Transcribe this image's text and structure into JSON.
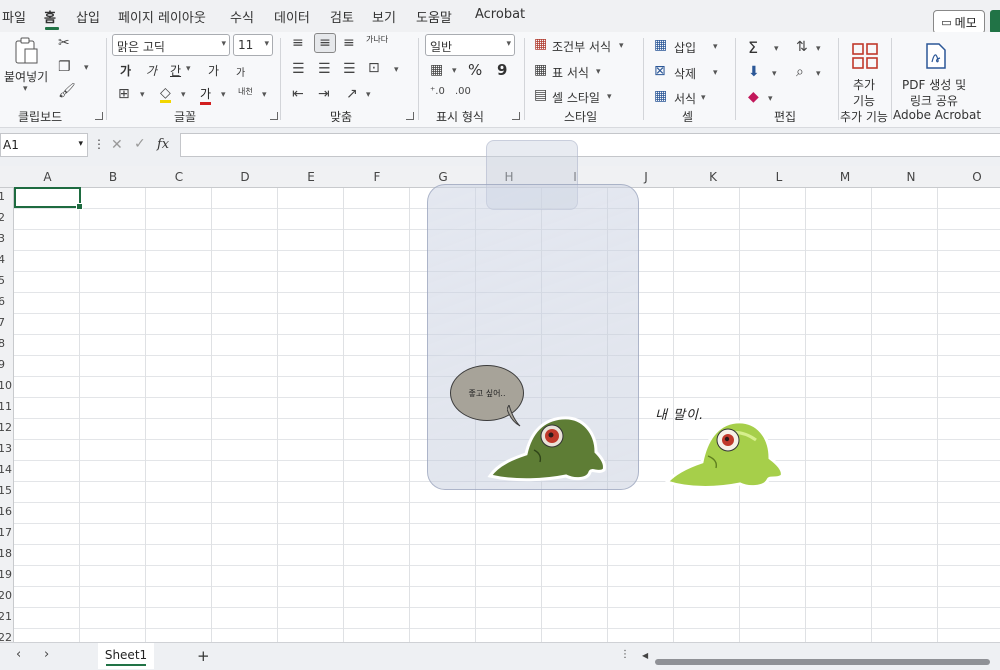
{
  "menu": {
    "items": [
      "파일",
      "홈",
      "삽입",
      "페이지 레이아웃",
      "수식",
      "데이터",
      "검토",
      "보기",
      "도움말",
      "Acrobat"
    ],
    "active_index": 1,
    "memo_label": "메모"
  },
  "ribbon": {
    "clipboard": {
      "paste_label": "붙여넣기",
      "group_label": "클립보드"
    },
    "font": {
      "font_name": "맑은 고딕",
      "font_size": "11",
      "group_label": "글꼴",
      "bold_label": "가",
      "italic_label": "가",
      "underline_label": "간",
      "grow_label": "가",
      "shrink_label": "가",
      "color_label": "가",
      "phonetic_label": "내천"
    },
    "alignment": {
      "group_label": "맞춤",
      "wrap_label": "가나다"
    },
    "number": {
      "format_value": "일반",
      "percent_symbol": "%",
      "comma_symbol": "9",
      "group_label": "표시 형식"
    },
    "styles": {
      "conditional_label": "조건부 서식",
      "table_label": "표 서식",
      "cell_style_label": "셀 스타일",
      "group_label": "스타일"
    },
    "cells": {
      "insert_label": "삽입",
      "delete_label": "삭제",
      "format_label": "서식",
      "group_label": "셀"
    },
    "editing": {
      "sum_symbol": "Σ",
      "group_label": "편집"
    },
    "addins": {
      "button_label_1": "추가",
      "button_label_2": "기능",
      "group_label": "추가 기능"
    },
    "acrobat": {
      "button_label_1": "PDF 생성 및",
      "button_label_2": "링크 공유",
      "group_label": "Adobe Acrobat"
    }
  },
  "formula_bar": {
    "name_box_value": "A1",
    "fx_label": "fx",
    "formula_value": ""
  },
  "grid": {
    "columns": [
      "A",
      "B",
      "C",
      "D",
      "E",
      "F",
      "G",
      "H",
      "I",
      "J",
      "K",
      "L",
      "M",
      "N",
      "O"
    ],
    "rows": [
      "1",
      "2",
      "3",
      "4",
      "5",
      "6",
      "7",
      "8",
      "9",
      "10",
      "11",
      "12",
      "13",
      "14",
      "15",
      "16",
      "17",
      "18",
      "19",
      "20",
      "21",
      "22"
    ],
    "selected_cell": "A1"
  },
  "objects": {
    "speech_bubble_text": "좋고 싶어..",
    "handwritten_text": "내 말이."
  },
  "sheet_tabs": {
    "tabs": [
      "Sheet1"
    ],
    "add_symbol": "+"
  },
  "colors": {
    "excel_green": "#217346",
    "slime_dark": "#5e7d35",
    "slime_light": "#a6cf4a",
    "eye_red": "#c0392b"
  }
}
